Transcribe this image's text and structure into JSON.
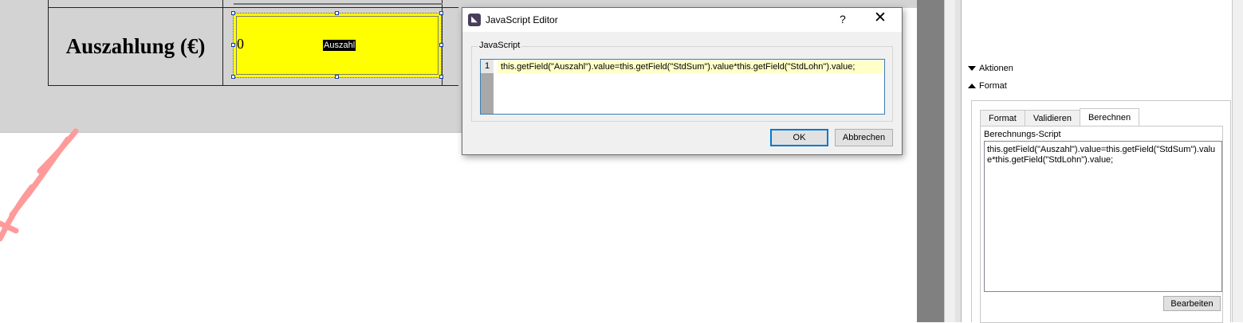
{
  "document": {
    "row_label": "Auszahlung (€)",
    "field_value": "0",
    "field_name": "Auszahl"
  },
  "dialog": {
    "title": "JavaScript Editor",
    "help_label": "?",
    "close_label": "✕",
    "group_label": "JavaScript",
    "line_number": "1",
    "code": "this.getField(\"Auszahl\").value=this.getField(\"StdSum\").value*this.getField(\"StdLohn\").value;",
    "ok_label": "OK",
    "cancel_label": "Abbrechen"
  },
  "properties": {
    "sections": [
      {
        "label": "Aktionen",
        "expanded": false
      },
      {
        "label": "Format",
        "expanded": true
      }
    ],
    "tabs": [
      {
        "label": "Format",
        "active": false
      },
      {
        "label": "Validieren",
        "active": false
      },
      {
        "label": "Berechnen",
        "active": true
      }
    ],
    "script_label": "Berechnungs-Script",
    "script_text": "this.getField(\"Auszahl\").value=this.getField(\"StdSum\").value*this.getField(\"StdLohn\").value;",
    "edit_button": "Bearbeiten"
  },
  "colors": {
    "field_fill": "#ffff00",
    "watermark": "#ff9a9a",
    "selection_handle": "#1a3fa8",
    "dialog_ok_border": "#0078d7"
  }
}
